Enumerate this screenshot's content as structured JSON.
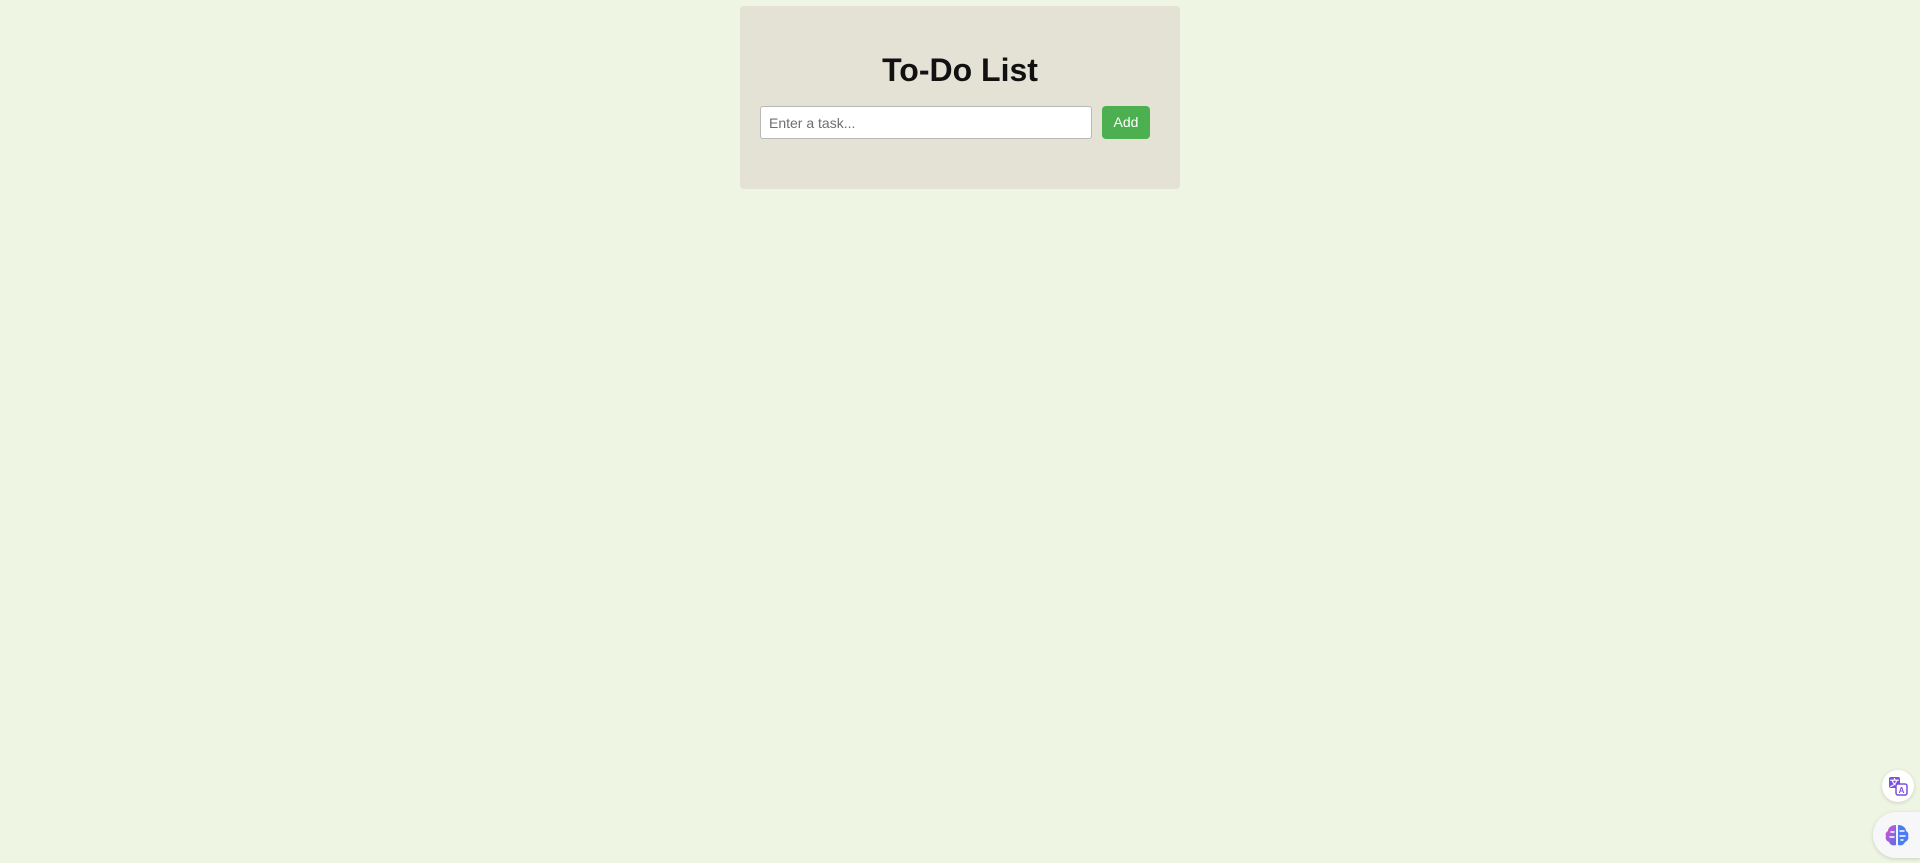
{
  "app": {
    "title": "To-Do List"
  },
  "task_input": {
    "placeholder": "Enter a task...",
    "value": ""
  },
  "add_button": {
    "label": "Add"
  },
  "colors": {
    "page_background": "#eff5e3",
    "card_background": "#e4e1d5",
    "accent_button": "#4caf50"
  },
  "floating_buttons": [
    {
      "icon": "translate-icon"
    },
    {
      "icon": "brain-icon"
    }
  ]
}
